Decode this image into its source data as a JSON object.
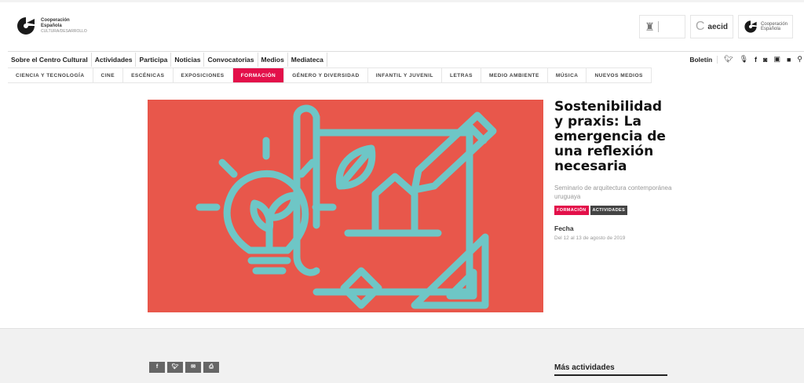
{
  "brand": {
    "line1": "Cooperación",
    "line2": "Española",
    "line3": "CULTURA/DESARROLLO"
  },
  "partners": {
    "aecid": "aecid",
    "coop_line1": "Cooperación",
    "coop_line2": "Española"
  },
  "nav_main": [
    "Sobre el Centro Cultural",
    "Actividades",
    "Participa",
    "Noticias",
    "Convocatorias",
    "Medios",
    "Mediateca"
  ],
  "nav_right": {
    "boletin": "Boletín"
  },
  "nav_categories": [
    "CIENCIA Y TECNOLOGÍA",
    "CINE",
    "ESCÉNICAS",
    "EXPOSICIONES",
    "FORMACIÓN",
    "GÉNERO Y DIVERSIDAD",
    "INFANTIL Y JUVENIL",
    "LETRAS",
    "MEDIO AMBIENTE",
    "MÚSICA",
    "NUEVOS MEDIOS"
  ],
  "active_category": "FORMACIÓN",
  "event": {
    "title": "Sostenibilidad y praxis: La emergencia de una reflexión necesaria",
    "subtitle": "Seminario de arquitectura contemporánea uruguaya",
    "tags": [
      "FORMACIÓN",
      "ACTIVIDADES"
    ],
    "fecha_label": "Fecha",
    "fecha_value": "Del 12 al 13 de agosto de 2019"
  },
  "more": {
    "label": "Más actividades"
  },
  "colors": {
    "hero_bg": "#e8574b",
    "hero_line": "#6ec6c6",
    "accent": "#e3104a",
    "tag_dark": "#444444"
  },
  "icons": [
    "twitter-icon",
    "microphone-icon",
    "facebook-icon",
    "instagram-icon",
    "flickr-icon",
    "youtube-icon",
    "search-icon"
  ]
}
